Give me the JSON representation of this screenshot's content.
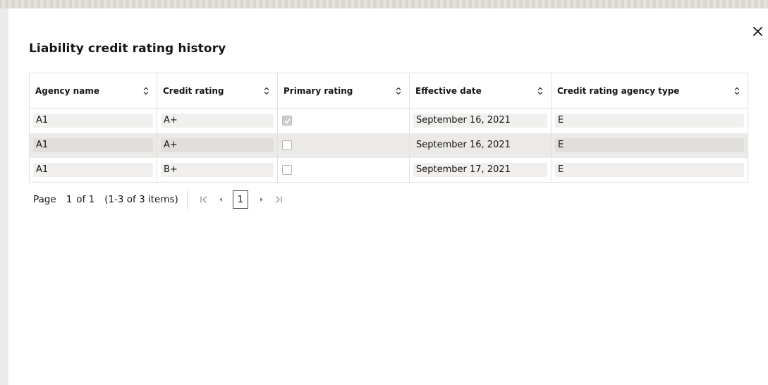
{
  "dialog": {
    "title": "Liability credit rating history",
    "close_icon": "close-icon"
  },
  "table": {
    "columns": [
      {
        "label": "Agency name"
      },
      {
        "label": "Credit rating"
      },
      {
        "label": "Primary rating"
      },
      {
        "label": "Effective date"
      },
      {
        "label": "Credit rating agency type"
      }
    ],
    "rows": [
      {
        "agency_name": "A1",
        "credit_rating": "A+",
        "primary_rating": true,
        "effective_date": "September 16, 2021",
        "agency_type": "E"
      },
      {
        "agency_name": "A1",
        "credit_rating": "A+",
        "primary_rating": false,
        "effective_date": "September 16, 2021",
        "agency_type": "E"
      },
      {
        "agency_name": "A1",
        "credit_rating": "B+",
        "primary_rating": false,
        "effective_date": "September 17, 2021",
        "agency_type": "E"
      }
    ]
  },
  "pagination": {
    "page_label": "Page",
    "current_page": "1",
    "of_total": "of 1",
    "items_summary": "(1-3 of 3 items)",
    "page_button": "1",
    "first_icon": "first-page-icon",
    "prev_icon": "previous-page-icon",
    "next_icon": "next-page-icon",
    "last_icon": "last-page-icon"
  }
}
